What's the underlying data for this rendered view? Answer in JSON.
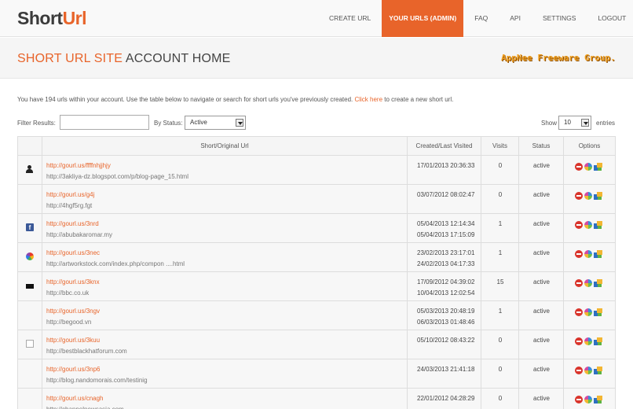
{
  "app": {
    "logo_part1": "Short",
    "logo_part2": "Url"
  },
  "nav": [
    {
      "label": "CREATE URL",
      "active": false
    },
    {
      "label": "YOUR URLS (ADMIN)",
      "active": true
    },
    {
      "label": "FAQ",
      "active": false
    },
    {
      "label": "API",
      "active": false
    },
    {
      "label": "SETTINGS",
      "active": false
    },
    {
      "label": "LOGOUT",
      "active": false
    }
  ],
  "page": {
    "title_accent": "SHORT URL SITE",
    "title_rest": " ACCOUNT HOME"
  },
  "watermark": "AppNee Freeware Group.",
  "intro": {
    "text": "You have 194 urls within your account. Use the table below to navigate or search for short urls you've previously created. ",
    "link": "Click here",
    "suffix": " to create a new short url."
  },
  "filters": {
    "filter_label": "Filter Results:",
    "filter_value": "",
    "status_label": "By Status:",
    "status_value": "Active",
    "show_label": "Show",
    "show_value": "10",
    "entries_label": "entries"
  },
  "table": {
    "headers": {
      "url": "Short/Original Url",
      "date": "Created/Last Visited",
      "visits": "Visits",
      "status": "Status",
      "options": "Options"
    },
    "rows": [
      {
        "icon": "person-favicon",
        "short": "http://gourl.us/ffffnhjjhjy",
        "original": "http://3akliya-dz.blogspot.com/p/blog-page_15.html",
        "created": "17/01/2013 20:36:33",
        "visited": "",
        "visits": "0",
        "status": "active"
      },
      {
        "icon": "blank-favicon",
        "short": "http://gourl.us/g4j",
        "original": "http://4hgf5rg.fgt",
        "created": "03/07/2012 08:02:47",
        "visited": "",
        "visits": "0",
        "status": "active"
      },
      {
        "icon": "facebook-favicon",
        "short": "http://gourl.us/3nrd",
        "original": "http://abubakaromar.my",
        "created": "05/04/2013 12:14:34",
        "visited": "05/04/2013 17:15:09",
        "visits": "1",
        "status": "active"
      },
      {
        "icon": "colorball-favicon",
        "short": "http://gourl.us/3nec",
        "original": "http://artworkstock.com/index.php/compon ....html",
        "created": "23/02/2013 23:17:01",
        "visited": "24/02/2013 04:17:33",
        "visits": "1",
        "status": "active"
      },
      {
        "icon": "bbc-favicon",
        "short": "http://gourl.us/3knx",
        "original": "http://bbc.co.uk",
        "created": "17/09/2012 04:39:02",
        "visited": "10/04/2013 12:02:54",
        "visits": "15",
        "status": "active"
      },
      {
        "icon": "blank-favicon",
        "short": "http://gourl.us/3ngv",
        "original": "http://begood.vn",
        "created": "05/03/2013 20:48:19",
        "visited": "06/03/2013 01:48:46",
        "visits": "1",
        "status": "active"
      },
      {
        "icon": "box-favicon",
        "short": "http://gourl.us/3kuu",
        "original": "http://bestblackhatforum.com",
        "created": "05/10/2012 08:43:22",
        "visited": "",
        "visits": "0",
        "status": "active"
      },
      {
        "icon": "blank-favicon",
        "short": "http://gourl.us/3np6",
        "original": "http://blog.nandomorais.com/testinig",
        "created": "24/03/2013 21:41:18",
        "visited": "",
        "visits": "0",
        "status": "active"
      },
      {
        "icon": "blank-favicon",
        "short": "http://gourl.us/cnagh",
        "original": "http://channelnewsasia.com",
        "created": "22/01/2012 04:28:29",
        "visited": "",
        "visits": "0",
        "status": "active"
      }
    ]
  },
  "option_icons": [
    "delete-icon",
    "stats-icon",
    "edit-icon"
  ]
}
